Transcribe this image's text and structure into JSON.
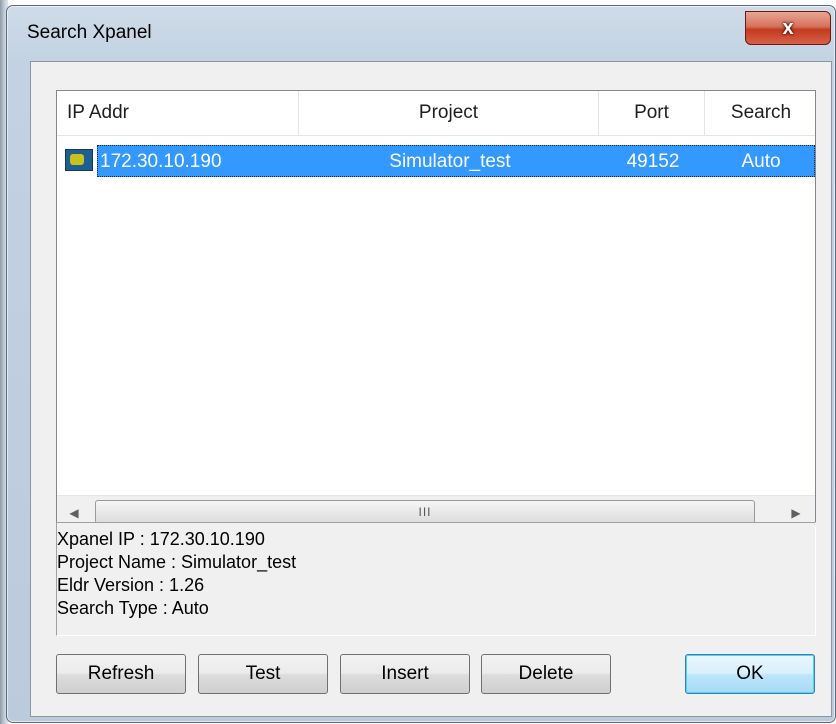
{
  "window": {
    "title": "Search Xpanel",
    "close_label": "x"
  },
  "list": {
    "columns": [
      "IP Addr",
      "Project",
      "Port",
      "Search"
    ],
    "rows": [
      {
        "ip": "172.30.10.190",
        "project": "Simulator_test",
        "port": "49152",
        "search": "Auto",
        "icon": "device-icon",
        "selected": true
      }
    ],
    "scrollbar": {
      "left_arrow": "◀",
      "right_arrow": "▶",
      "thumb_grip": "III"
    }
  },
  "info": {
    "lines": [
      "Xpanel IP : 172.30.10.190",
      "Project Name : Simulator_test",
      "Eldr Version : 1.26",
      "Search Type : Auto"
    ]
  },
  "buttons": {
    "refresh": "Refresh",
    "test": "Test",
    "insert": "Insert",
    "delete": "Delete",
    "ok": "OK"
  },
  "colors": {
    "selection": "#3399ff",
    "close_button": "#c23a1e"
  }
}
